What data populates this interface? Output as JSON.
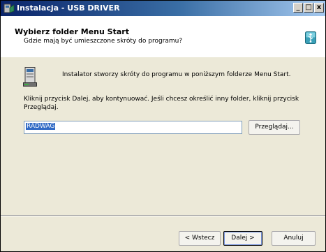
{
  "window": {
    "title": "Instalacja - USB DRIVER",
    "controls": {
      "minimize": "_",
      "maximize": "□",
      "close": "x"
    }
  },
  "header": {
    "title": "Wybierz folder Menu Start",
    "subtitle": "Gdzie mają być umieszczone skróty do programu?"
  },
  "body": {
    "info": "Instalator stworzy skróty do programu w poniższym folderze Menu Start.",
    "instruction": "Kliknij przycisk Dalej, aby kontynuować. Jeśli chcesz określić inny folder, kliknij przycisk Przeglądaj.",
    "folder_value": "RADWAG",
    "browse_label": "Przeglądaj..."
  },
  "footer": {
    "back_label": "< Wstecz",
    "next_label": "Dalej >",
    "cancel_label": "Anuluj"
  },
  "colors": {
    "titlebar_start": "#0a246a",
    "titlebar_end": "#a6caf0",
    "dialog_bg": "#ece9d8",
    "selection": "#316ac5"
  }
}
